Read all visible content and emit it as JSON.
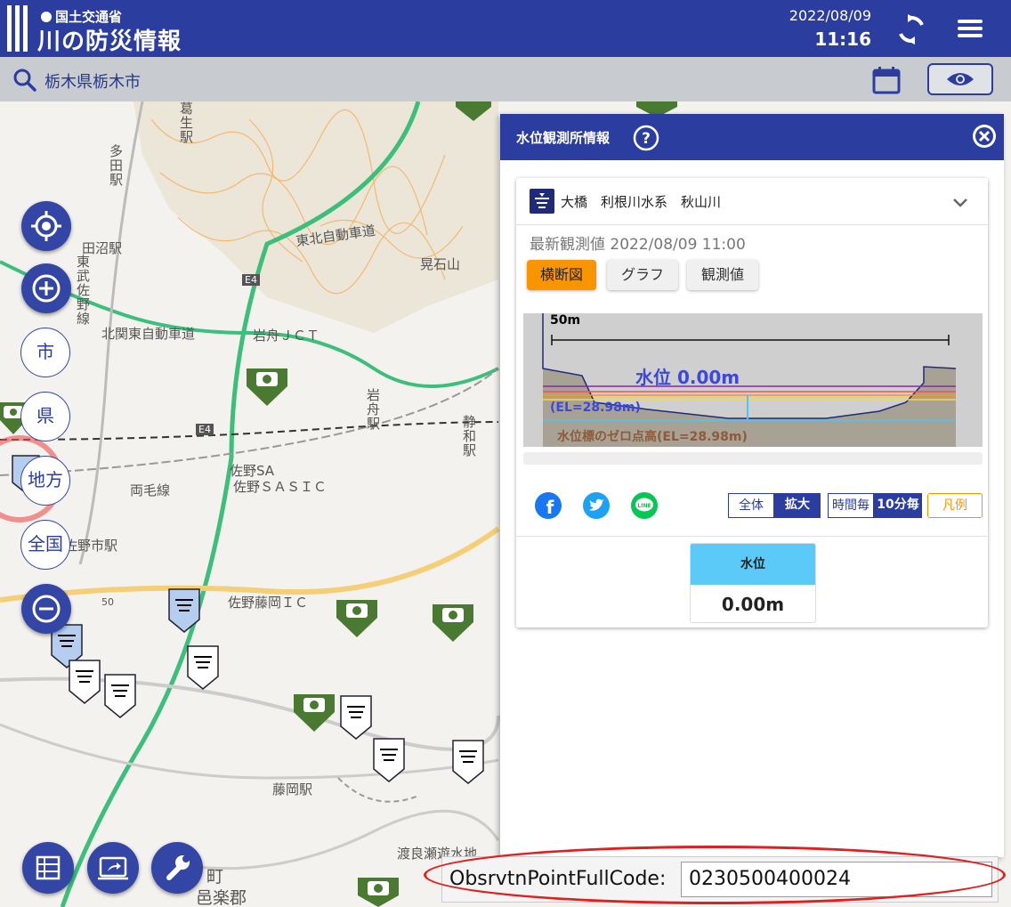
{
  "header": {
    "ministry": "国土交通省",
    "app_title": "川の防災情報",
    "date": "2022/08/09",
    "time": "11:16"
  },
  "search": {
    "location": "栃木県栃木市"
  },
  "map_controls": {
    "city": "市",
    "prefecture": "県",
    "region": "地方",
    "nation": "全国"
  },
  "map_labels": {
    "kuzu_station": "葛生駅",
    "tado_station": "多田駅",
    "tanuma_station": "田沼駅",
    "tobu_sano_line": "東武佐野線",
    "kitakanto_expressway": "北関東自動車道",
    "tohoku_expressway": "東北自動車道",
    "akaishiyama": "晃石山",
    "e4": "E4",
    "iwafune_jct": "岩舟ＪＣＴ",
    "iwafune_station": "岩舟駅",
    "shizuwa_station": "静和駅",
    "sano_sa": "佐野SA",
    "sano_sasic": "佐野ＳＡＳＩＣ",
    "ryomo_line": "両毛線",
    "sano_city_station": "佐野市駅",
    "sano_fujioka_ic": "佐野藤岡ＩＣ",
    "route50": "50",
    "fujioka_station": "藤岡駅",
    "watarase_reservoir": "渡良瀬遊水地",
    "machi": "町",
    "oura_gun": "邑楽郡"
  },
  "panel": {
    "title": "水位観測所情報",
    "station_name": "大橋　利根川水系　秋山川",
    "latest_obs": "最新観測値 2022/08/09 11:00",
    "tabs": [
      "横断図",
      "グラフ",
      "観測値"
    ],
    "cross_section": {
      "scale": "50m",
      "water_level": "水位 0.00m",
      "elevation": "(EL=28.98m)",
      "zero_point": "水位標のゼロ点高(EL=28.98m)"
    },
    "view_toggle": [
      "全体",
      "拡大"
    ],
    "interval_toggle": [
      "時間毎",
      "10分毎"
    ],
    "legend": "凡例",
    "table_header": "水位",
    "table_value": "0.00m"
  },
  "code_field": {
    "label": "ObsrvtnPointFullCode:",
    "value": "0230500400024"
  },
  "colors": {
    "header": "#2b3d9f",
    "accent_orange": "#f99500",
    "water_level_cell": "#5ccaf8",
    "highlight_ellipse": "#e02020"
  }
}
